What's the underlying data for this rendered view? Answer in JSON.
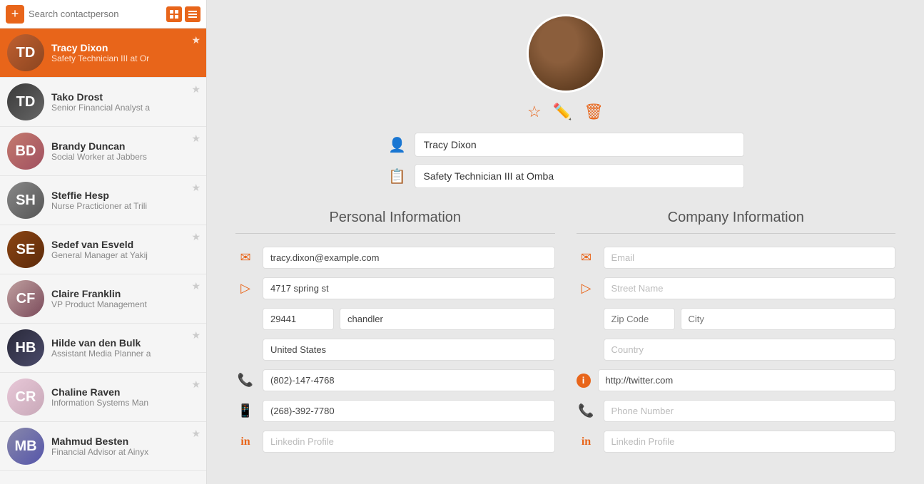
{
  "sidebar": {
    "search_placeholder": "Search contactperson",
    "add_label": "+",
    "contacts": [
      {
        "id": "tracy-dixon",
        "name": "Tracy Dixon",
        "title": "Safety Technician III at Or",
        "active": true,
        "avatar_class": "av-tracy",
        "initials": "TD"
      },
      {
        "id": "tako-drost",
        "name": "Tako Drost",
        "title": "Senior Financial Analyst a",
        "active": false,
        "avatar_class": "av-tako",
        "initials": "TD"
      },
      {
        "id": "brandy-duncan",
        "name": "Brandy Duncan",
        "title": "Social Worker at Jabbers",
        "active": false,
        "avatar_class": "av-brandy",
        "initials": "BD"
      },
      {
        "id": "steffie-hesp",
        "name": "Steffie Hesp",
        "title": "Nurse Practicioner at Trili",
        "active": false,
        "avatar_class": "av-steffie",
        "initials": "SH"
      },
      {
        "id": "sedef-van-esveld",
        "name": "Sedef van Esveld",
        "title": "General Manager at Yakij",
        "active": false,
        "avatar_class": "av-sedef",
        "initials": "SE"
      },
      {
        "id": "claire-franklin",
        "name": "Claire Franklin",
        "title": "VP Product Management",
        "active": false,
        "avatar_class": "av-claire",
        "initials": "CF"
      },
      {
        "id": "hilde-van-den-bulk",
        "name": "Hilde van den Bulk",
        "title": "Assistant Media Planner a",
        "active": false,
        "avatar_class": "av-hilde",
        "initials": "HB"
      },
      {
        "id": "chaline-raven",
        "name": "Chaline Raven",
        "title": "Information Systems Man",
        "active": false,
        "avatar_class": "av-chaline",
        "initials": "CR"
      },
      {
        "id": "mahmud-besten",
        "name": "Mahmud Besten",
        "title": "Financial Advisor at Ainyx",
        "active": false,
        "avatar_class": "av-mahmud",
        "initials": "MB"
      }
    ]
  },
  "profile": {
    "name": "Tracy Dixon",
    "job_title": "Safety Technician III at Omba",
    "personal": {
      "section_title": "Personal Information",
      "email": "tracy.dixon@example.com",
      "email_placeholder": "",
      "street": "4717 spring st",
      "street_placeholder": "",
      "zip": "29441",
      "city": "chandler",
      "country": "United States",
      "phone": "(802)-147-4768",
      "mobile": "(268)-392-7780",
      "linkedin": "",
      "linkedin_placeholder": "Linkedin Profile"
    },
    "company": {
      "section_title": "Company Information",
      "email_placeholder": "Email",
      "street_placeholder": "Street Name",
      "zip_placeholder": "Zip Code",
      "city_placeholder": "City",
      "country_placeholder": "Country",
      "website": "http://twitter.com",
      "phone_placeholder": "Phone Number",
      "linkedin_placeholder": "Linkedin Profile"
    }
  }
}
